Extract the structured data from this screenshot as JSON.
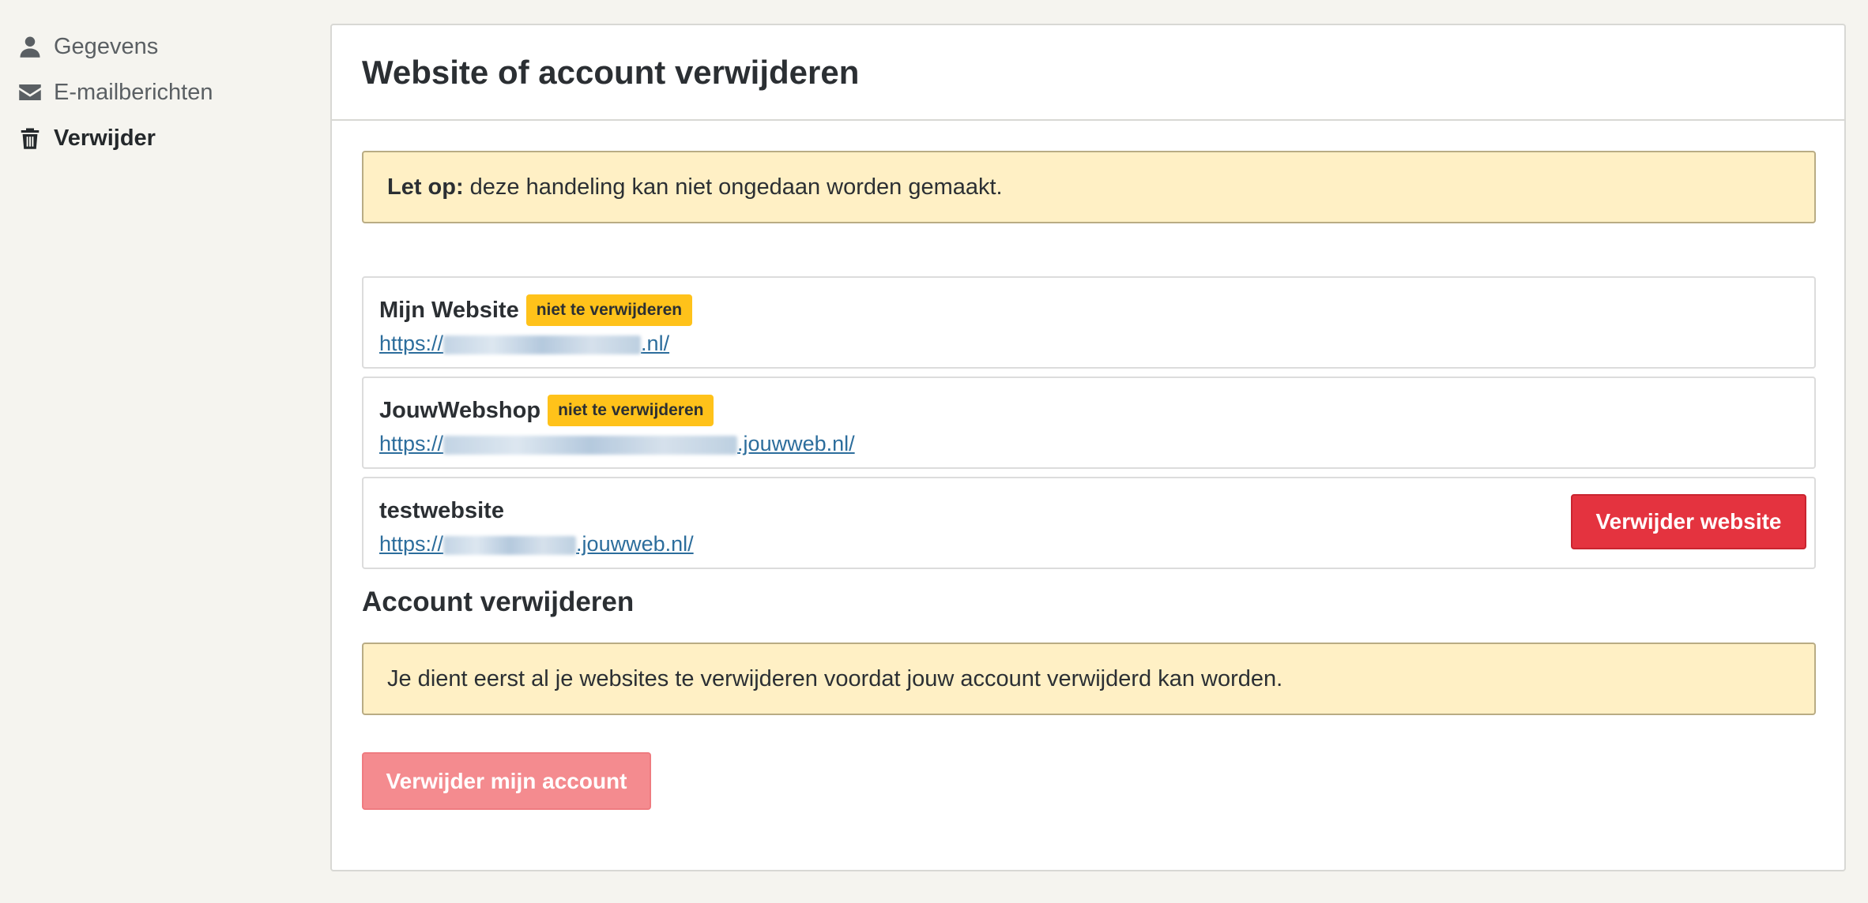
{
  "sidebar": {
    "items": [
      {
        "label": "Gegevens",
        "icon": "user-icon"
      },
      {
        "label": "E-mailberichten",
        "icon": "envelope-icon"
      },
      {
        "label": "Verwijder",
        "icon": "trash-icon",
        "active": true
      }
    ]
  },
  "panel": {
    "title": "Website of account verwijderen",
    "warning": {
      "label": "Let op:",
      "text": "deze handeling kan niet ongedaan worden gemaakt."
    },
    "websites": [
      {
        "name": "Mijn Website",
        "badge": "niet te verwijderen",
        "url_prefix": "https://",
        "url_suffix": ".nl/"
      },
      {
        "name": "JouwWebshop",
        "badge": "niet te verwijderen",
        "url_prefix": "https://",
        "url_suffix": ".jouwweb.nl/"
      },
      {
        "name": "testwebsite",
        "url_prefix": "https://",
        "url_suffix": ".jouwweb.nl/",
        "delete_label": "Verwijder website"
      }
    ],
    "account_section": {
      "title": "Account verwijderen",
      "notice": "Je dient eerst al je websites te verwijderen voordat jouw account verwijderd kan worden.",
      "delete_label": "Verwijder mijn account"
    }
  },
  "colors": {
    "background": "#f5f4ef",
    "warning_bg": "#fff0c5",
    "badge": "#ffc21a",
    "danger": "#e4333f",
    "danger_disabled": "#f48b8f",
    "link": "#2c6d9c"
  }
}
